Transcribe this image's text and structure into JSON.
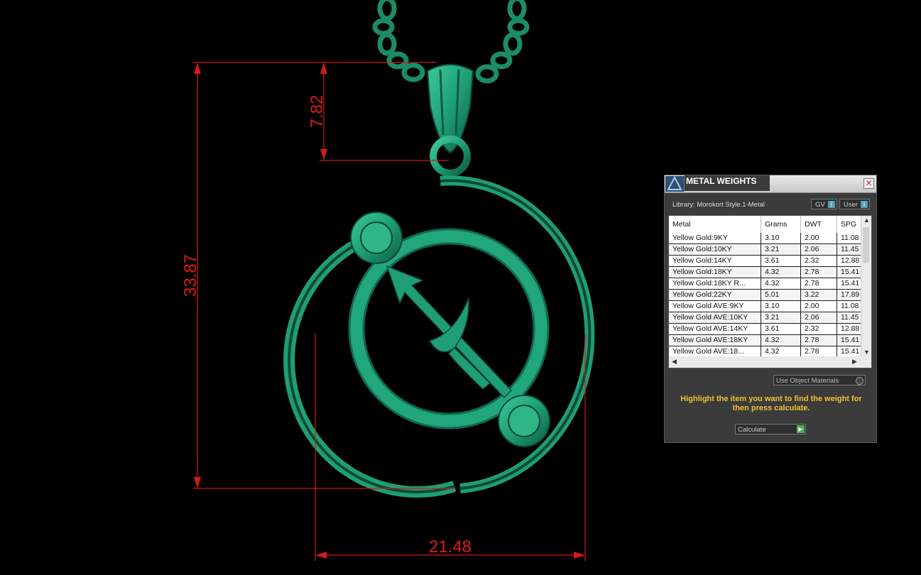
{
  "dimensions": {
    "height_total": "33.87",
    "bail_height": "7.82",
    "width_total": "21.48",
    "color": "#e01a1a"
  },
  "model": {
    "material_color": "#1f9e75",
    "icons": [
      "chain",
      "bail",
      "pendant-ring",
      "sagittarius-arrow"
    ]
  },
  "dialog": {
    "title": "METAL WEIGHTS",
    "close_icon": "close-icon",
    "library": "Library: Morokort Style.1-Metal",
    "toggle_gv": "GV",
    "toggle_user": "User",
    "columns": [
      "Metal",
      "Grams",
      "DWT",
      "SPG"
    ],
    "rows": [
      {
        "metal": "Yellow Gold:9KY",
        "grams": "3.10",
        "dwt": "2.00",
        "spg": "11.08"
      },
      {
        "metal": "Yellow Gold:10KY",
        "grams": "3.21",
        "dwt": "2.06",
        "spg": "11.45"
      },
      {
        "metal": "Yellow Gold:14KY",
        "grams": "3.61",
        "dwt": "2.32",
        "spg": "12.88"
      },
      {
        "metal": "Yellow Gold:18KY",
        "grams": "4.32",
        "dwt": "2.78",
        "spg": "15.41"
      },
      {
        "metal": "Yellow Gold:18KY R...",
        "grams": "4.32",
        "dwt": "2.78",
        "spg": "15.41"
      },
      {
        "metal": "Yellow Gold:22KY",
        "grams": "5.01",
        "dwt": "3.22",
        "spg": "17.89"
      },
      {
        "metal": "Yellow Gold AVE:9KY",
        "grams": "3.10",
        "dwt": "2.00",
        "spg": "11.08"
      },
      {
        "metal": "Yellow Gold AVE:10KY",
        "grams": "3.21",
        "dwt": "2.06",
        "spg": "11.45"
      },
      {
        "metal": "Yellow Gold AVE:14KY",
        "grams": "3.61",
        "dwt": "2.32",
        "spg": "12.88"
      },
      {
        "metal": "Yellow Gold AVE:18KY",
        "grams": "4.32",
        "dwt": "2.78",
        "spg": "15.41"
      },
      {
        "metal": "Yellow Gold AVE:18...",
        "grams": "4.32",
        "dwt": "2.78",
        "spg": "15.41"
      }
    ],
    "use_object_materials": "Use Object Materials",
    "instruction": "Highlight the item you want to find the weight for then press calculate.",
    "calculate": "Calculate",
    "accent_color": "#f2c230"
  }
}
